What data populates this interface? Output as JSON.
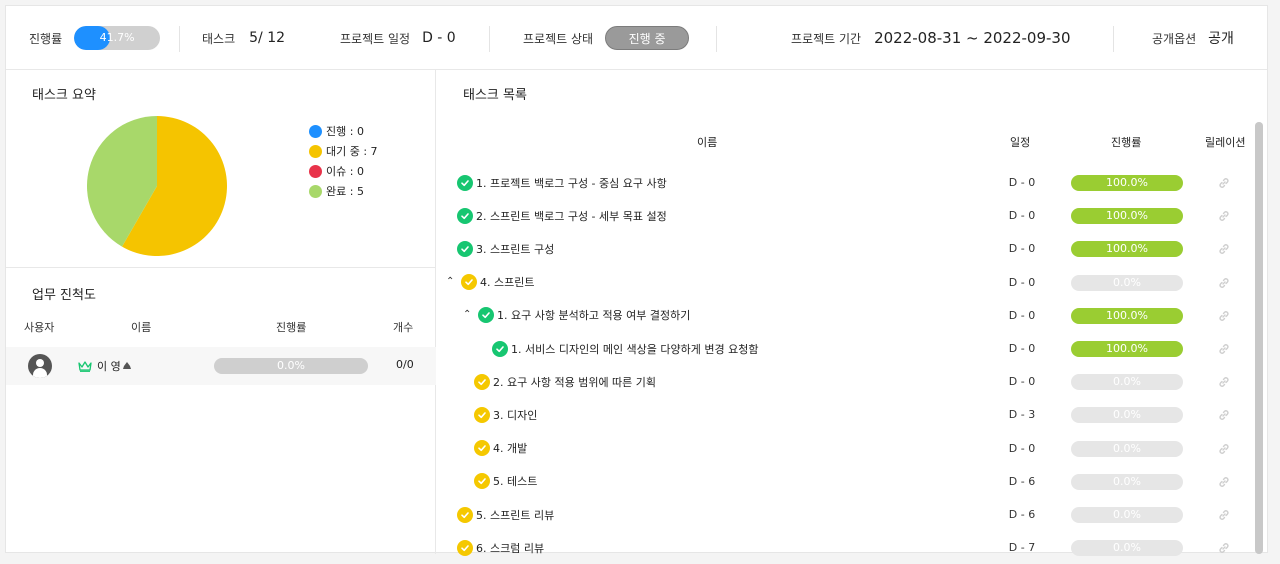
{
  "header": {
    "progress_label": "진행률",
    "progress_value": "41.7%",
    "progress_fraction": 0.417,
    "task_label": "태스크",
    "task_count": "5/ 12",
    "schedule_label": "프로젝트 일정",
    "schedule_value": "D - 0",
    "status_label": "프로젝트 상태",
    "status_value": "진행 중",
    "period_label": "프로젝트 기간",
    "period_value": "2022-08-31 ~ 2022-09-30",
    "visibility_label": "공개옵션",
    "visibility_value": "공개"
  },
  "summary": {
    "title": "태스크 요약",
    "legend": [
      {
        "label": "진행 : 0",
        "color": "#1e90ff"
      },
      {
        "label": "대기 중 : 7",
        "color": "#f5c400"
      },
      {
        "label": "이슈 : 0",
        "color": "#e8334a"
      },
      {
        "label": "완료 : 5",
        "color": "#a8d86a"
      }
    ],
    "pie": {
      "waiting": 7,
      "done": 5
    }
  },
  "work_progress": {
    "title": "업무 진척도",
    "columns": [
      "사용자",
      "이름",
      "진행률",
      "개수"
    ],
    "rows": [
      {
        "name": "이 영",
        "progress": "0.0%",
        "count": "0/0"
      }
    ]
  },
  "task_list": {
    "title": "태스크 목록",
    "columns": [
      "이름",
      "일정",
      "진행률",
      "릴레이션"
    ],
    "tasks": [
      {
        "name": "1. 프로젝트 백로그 구성 - 중심 요구 사항",
        "date": "D - 0",
        "progress": "100.0%",
        "status": "done"
      },
      {
        "name": "2. 스프린트 백로그 구성 - 세부 목표 설정",
        "date": "D - 0",
        "progress": "100.0%",
        "status": "done"
      },
      {
        "name": "3. 스프린트 구성",
        "date": "D - 0",
        "progress": "100.0%",
        "status": "done"
      },
      {
        "name": "4. 스프린트",
        "date": "D - 0",
        "progress": "0.0%",
        "status": "waiting"
      },
      {
        "name": "1. 요구 사항 분석하고 적용 여부 결정하기",
        "date": "D - 0",
        "progress": "100.0%",
        "status": "done"
      },
      {
        "name": "1. 서비스 디자인의 메인 색상을 다양하게 변경 요청함",
        "date": "D - 0",
        "progress": "100.0%",
        "status": "done"
      },
      {
        "name": "2. 요구 사항 적용 범위에 따른 기획",
        "date": "D - 0",
        "progress": "0.0%",
        "status": "waiting"
      },
      {
        "name": "3. 디자인",
        "date": "D - 3",
        "progress": "0.0%",
        "status": "waiting"
      },
      {
        "name": "4. 개발",
        "date": "D - 0",
        "progress": "0.0%",
        "status": "waiting"
      },
      {
        "name": "5. 테스트",
        "date": "D - 6",
        "progress": "0.0%",
        "status": "waiting"
      },
      {
        "name": "5. 스프린트 리뷰",
        "date": "D - 6",
        "progress": "0.0%",
        "status": "waiting"
      },
      {
        "name": "6. 스크럼 리뷰",
        "date": "D - 7",
        "progress": "0.0%",
        "status": "waiting"
      }
    ]
  }
}
